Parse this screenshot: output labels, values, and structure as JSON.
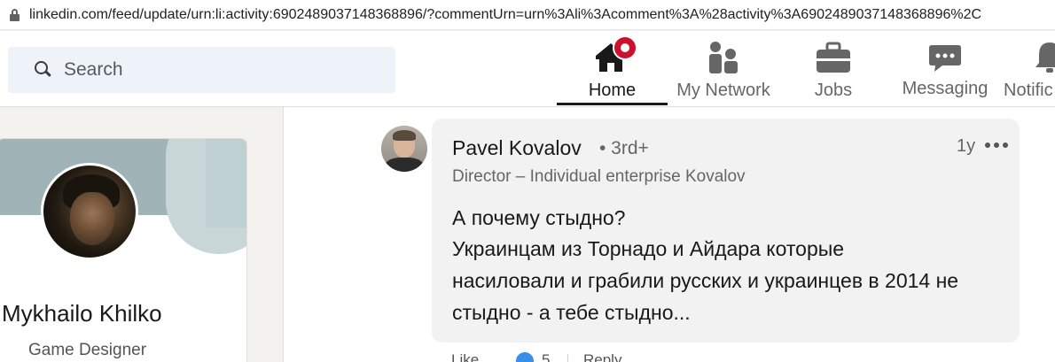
{
  "browser": {
    "url": "linkedin.com/feed/update/urn:li:activity:6902489037148368896/?commentUrn=urn%3Ali%3Acomment%3A%28activity%3A6902489037148368896%2C"
  },
  "nav": {
    "search_placeholder": "Search",
    "items": [
      {
        "label": "Home",
        "icon": "home-icon",
        "active": true,
        "notification": true
      },
      {
        "label": "My Network",
        "icon": "network-icon",
        "active": false
      },
      {
        "label": "Jobs",
        "icon": "briefcase-icon",
        "active": false
      },
      {
        "label": "Messaging",
        "icon": "messaging-icon",
        "active": false
      },
      {
        "label": "Notific",
        "icon": "bell-icon",
        "active": false
      }
    ],
    "notification_color": "#cb112d"
  },
  "profile": {
    "name": "Mykhailo Khilko",
    "headline": "Game Designer"
  },
  "comment": {
    "author": "Pavel Kovalov",
    "degree": "• 3rd+",
    "time": "1y",
    "headline": "Director – Individual enterprise Kovalov",
    "lines": [
      "А почему стыдно?",
      "Украинцам из Торнадо и Айдара которые",
      "насиловали и грабили русских и украинцев в 2014 не",
      "стыдно - а тебе стыдно..."
    ],
    "actions": {
      "like_label": "Like",
      "reaction_count": "5",
      "reply_label": "Reply"
    }
  }
}
